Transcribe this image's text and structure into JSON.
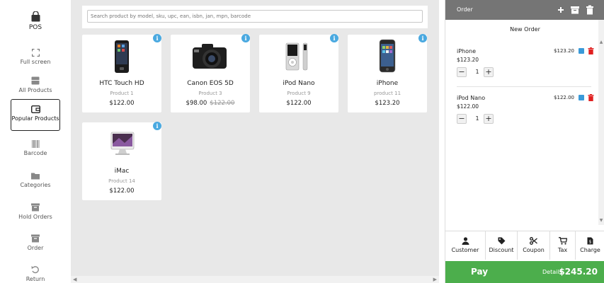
{
  "sidebar": {
    "logo_label": "POS",
    "items": [
      {
        "label": "Full screen",
        "icon": "fullscreen-icon"
      },
      {
        "label": "All Products",
        "icon": "box-icon"
      },
      {
        "label": "Popular Products",
        "icon": "wallet-icon"
      },
      {
        "label": "Barcode",
        "icon": "barcode-icon"
      },
      {
        "label": "Categories",
        "icon": "folder-icon"
      },
      {
        "label": "Hold Orders",
        "icon": "archive-icon"
      },
      {
        "label": "Order",
        "icon": "archive-icon"
      },
      {
        "label": "Return",
        "icon": "undo-icon"
      }
    ]
  },
  "search": {
    "placeholder": "Search product by model, sku, upc, ean, isbn, jan, mpn, barcode"
  },
  "products": [
    {
      "name": "HTC Touch HD",
      "model": "Product 1",
      "price": "$122.00"
    },
    {
      "name": "Canon EOS 5D",
      "model": "Product 3",
      "price": "$98.00",
      "old_price": "$122.00"
    },
    {
      "name": "iPod Nano",
      "model": "Product 9",
      "price": "$122.00"
    },
    {
      "name": "iPhone",
      "model": "product 11",
      "price": "$123.20"
    },
    {
      "name": "iMac",
      "model": "Product 14",
      "price": "$122.00"
    }
  ],
  "order": {
    "title": "Order",
    "new_order_label": "New Order",
    "items": [
      {
        "name": "iPhone",
        "unit_price": "$123.20",
        "line_price": "$123.20",
        "qty": "1"
      },
      {
        "name": "iPod Nano",
        "unit_price": "$122.00",
        "line_price": "$122.00",
        "qty": "1"
      }
    ]
  },
  "actions": [
    {
      "label": "Customer",
      "icon": "user-icon"
    },
    {
      "label": "Discount",
      "icon": "tag-icon"
    },
    {
      "label": "Coupon",
      "icon": "scissors-icon"
    },
    {
      "label": "Tax",
      "icon": "cart-icon"
    },
    {
      "label": "Charge",
      "icon": "receipt-icon"
    }
  ],
  "pay": {
    "label": "Pay",
    "details_label": "Details",
    "total": "$245.20"
  },
  "colors": {
    "accent_green": "#4cae4c",
    "header_gray": "#757575",
    "info_blue": "#4aa9e0",
    "delete_red": "#e02020",
    "edit_blue": "#3a9ad9"
  }
}
